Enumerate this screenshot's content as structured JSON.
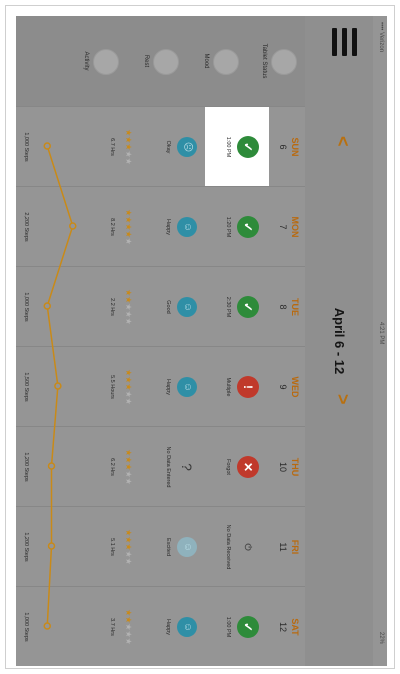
{
  "statusbar": {
    "carrier": "•••• Verizon",
    "time": "4:21 PM",
    "battery": "22%"
  },
  "nav": {
    "title": "April 6 - 12",
    "prev_glyph": "<",
    "next_glyph": ">"
  },
  "row_labels": {
    "tablet_status": "Tablet Status",
    "mood": "Mood",
    "rest": "Rest",
    "activity": "Activity"
  },
  "colors": {
    "accent": "#b86a10",
    "check": "#2e8b3a",
    "alert": "#c0392b",
    "mood": "#2f8fa6",
    "line": "#c98a18"
  },
  "days": [
    {
      "name": "SUN",
      "num": "6",
      "status_icon": "check",
      "status_text": "1:00 PM",
      "selected": true,
      "mood_icon": "sad-face",
      "mood_text": "Okay",
      "stars": 3,
      "rest_text": "6.7 Hrs",
      "steps": 1000,
      "steps_text": "1,000 Steps"
    },
    {
      "name": "MON",
      "num": "7",
      "status_icon": "check",
      "status_text": "1:20 PM",
      "selected": false,
      "mood_icon": "happy-face",
      "mood_text": "Happy",
      "stars": 4,
      "rest_text": "8.2 Hrs",
      "steps": 2200,
      "steps_text": "2,200 Steps"
    },
    {
      "name": "TUE",
      "num": "8",
      "status_icon": "check",
      "status_text": "2:30 PM",
      "selected": false,
      "mood_icon": "happy-face",
      "mood_text": "Good",
      "stars": 2,
      "rest_text": "2.2 Hrs",
      "steps": 1000,
      "steps_text": "1,000 Steps"
    },
    {
      "name": "WED",
      "num": "9",
      "status_icon": "exclamation",
      "status_text": "Multiple",
      "selected": false,
      "mood_icon": "happy-face",
      "mood_text": "Happy",
      "stars": 3,
      "rest_text": "5.5 Hours",
      "steps": 1500,
      "steps_text": "1,500 Steps"
    },
    {
      "name": "THU",
      "num": "10",
      "status_icon": "x",
      "status_text": "Forgot",
      "selected": false,
      "mood_icon": "question",
      "mood_text": "No Data Entered",
      "stars": 3,
      "rest_text": "6.2 Hrs",
      "steps": 1200,
      "steps_text": "1,200 Steps"
    },
    {
      "name": "FRI",
      "num": "11",
      "status_icon": "plug",
      "status_text": "No Data Received",
      "selected": false,
      "mood_icon": "excited-face",
      "mood_text": "Excited",
      "stars": 3,
      "rest_text": "5.1 Hrs",
      "steps": 1200,
      "steps_text": "1,200 Steps"
    },
    {
      "name": "SAT",
      "num": "12",
      "status_icon": "check",
      "status_text": "1:00 PM",
      "selected": false,
      "mood_icon": "happy-face",
      "mood_text": "Happy",
      "stars": 2,
      "rest_text": "3.7 Hrs",
      "steps": 1000,
      "steps_text": "1,000 Steps"
    }
  ]
}
